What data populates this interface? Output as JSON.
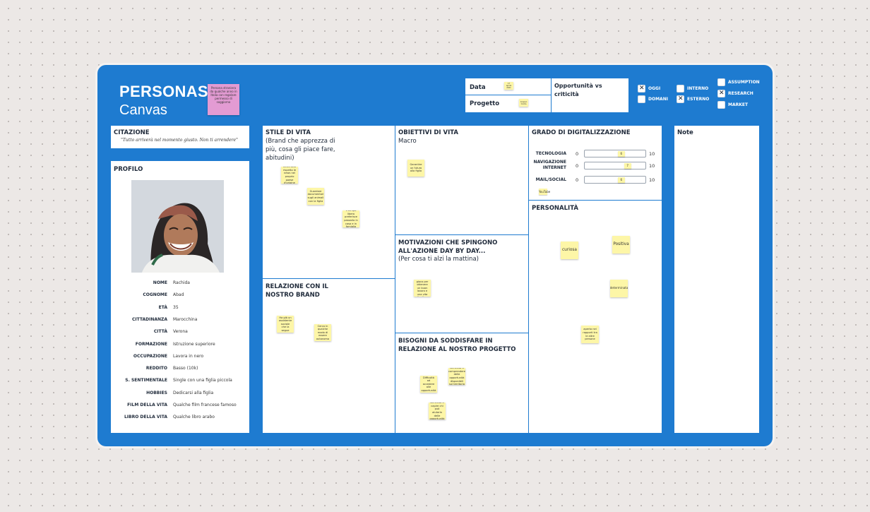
{
  "header": {
    "title": "PERSONAS",
    "subtitle": "Canvas",
    "note": "Persona straniera da qualche anno in Italia con regolare permesso di soggiorno",
    "data_label": "Data",
    "data_value": "17 aprile 2021",
    "progetto_label": "Progetto",
    "progetto_value": "Gruppo Civilia",
    "opportunita_label": "Opportunità vs criticità"
  },
  "checkboxes": [
    {
      "label": "OGGI",
      "checked": true
    },
    {
      "label": "DOMANI",
      "checked": false
    },
    {
      "label": "INTERNO",
      "checked": false
    },
    {
      "label": "ESTERNO",
      "checked": true
    },
    {
      "label": "ASSUMPTION",
      "checked": false
    },
    {
      "label": "RESEARCH",
      "checked": true
    },
    {
      "label": "MARKET",
      "checked": false
    }
  ],
  "citazione": {
    "title": "CITAZIONE",
    "quote": "\"Tutto arriverà nel momento giusto. Non ti arrendere\""
  },
  "profilo": {
    "title": "PROFILO",
    "photo_icon": "person-photo",
    "rows": [
      {
        "key": "NOME",
        "value": "Rachida"
      },
      {
        "key": "COGNOME",
        "value": "Abad"
      },
      {
        "key": "ETÀ",
        "value": "35"
      },
      {
        "key": "CITTADINANZA",
        "value": "Marocchina"
      },
      {
        "key": "CITTÀ",
        "value": "Verona"
      },
      {
        "key": "FORMAZIONE",
        "value": "Istruzione superiore"
      },
      {
        "key": "OCCUPAZIONE",
        "value": "Lavora in nero"
      },
      {
        "key": "REDDITO",
        "value": "Basso (10k)"
      },
      {
        "key": "S. SENTIMENTALE",
        "value": "Single con una figlia piccola"
      },
      {
        "key": "HOBBIES",
        "value": "Dedicarsi alla figlia"
      },
      {
        "key": "FILM DELLA VITA",
        "value": "Qualche film francese famoso"
      },
      {
        "key": "LIBRO DELLA VITA",
        "value": "Qualche libro arabo"
      }
    ]
  },
  "stile": {
    "title": "STILE DI VITA",
    "subtitle": "(Brand che apprezza di più, cosa gli piace fare, abitudini)",
    "notes": [
      "Informarsi rispetto le news nel proprio paese d'origine",
      "Guardare documentari sugli animali con la figlia",
      "Il tempo libero preferisce passarlo in casa e in famiglia"
    ]
  },
  "relazione": {
    "title": "RELAZIONE CON IL NOSTRO BRAND",
    "notes": [
      "Ha già un assistente sociale che la segue",
      "Cerca in qualche modo di essere autonoma"
    ]
  },
  "obiettivi": {
    "title": "OBIETTIVI DI VITA",
    "subtitle": "Macro",
    "notes": [
      "Garantire un futuro alla figlia"
    ]
  },
  "motivazioni": {
    "title": "MOTIVAZIONI CHE SPINGONO ALL'AZIONE DAY BY DAY...",
    "subtitle": "(Per cosa ti alzi la mattina)",
    "notes": [
      "Vedere in gioco per ottenere un buon lavoro e una vita dignitosa"
    ]
  },
  "bisogni": {
    "title": "BISOGNI DA SODDISFARE IN RELAZIONE AL NOSTRO PROGETTO",
    "notes": [
      "Difficoltà a comprendere delle opportunità disponibili sul territorio",
      "Difficoltà ad accedere alle opportunità",
      "Difficoltà a capire chi può aiutarla delle opportunità"
    ]
  },
  "digitalizzazione": {
    "title": "GRADO DI DIGITALIZZAZIONE",
    "min_label": "0",
    "max_label": "10",
    "rows": [
      {
        "label": "TECNOLOGIA",
        "value": 6
      },
      {
        "label": "NAVIGAZIONE INTERNET",
        "value": 7
      },
      {
        "label": "MAIL/SOCIAL",
        "value": 6
      }
    ],
    "extra_note": "YouTube"
  },
  "personalita": {
    "title": "PERSONALITÀ",
    "notes": [
      "curiosa",
      "Positiva",
      "determinata",
      "aperta nei rapporti tra le altre persone"
    ]
  },
  "note_panel": {
    "title": "Note"
  },
  "colors": {
    "board": "#1e7bd0",
    "sticky_yellow": "#fdf6a7",
    "sticky_pink": "#e39bd3"
  }
}
